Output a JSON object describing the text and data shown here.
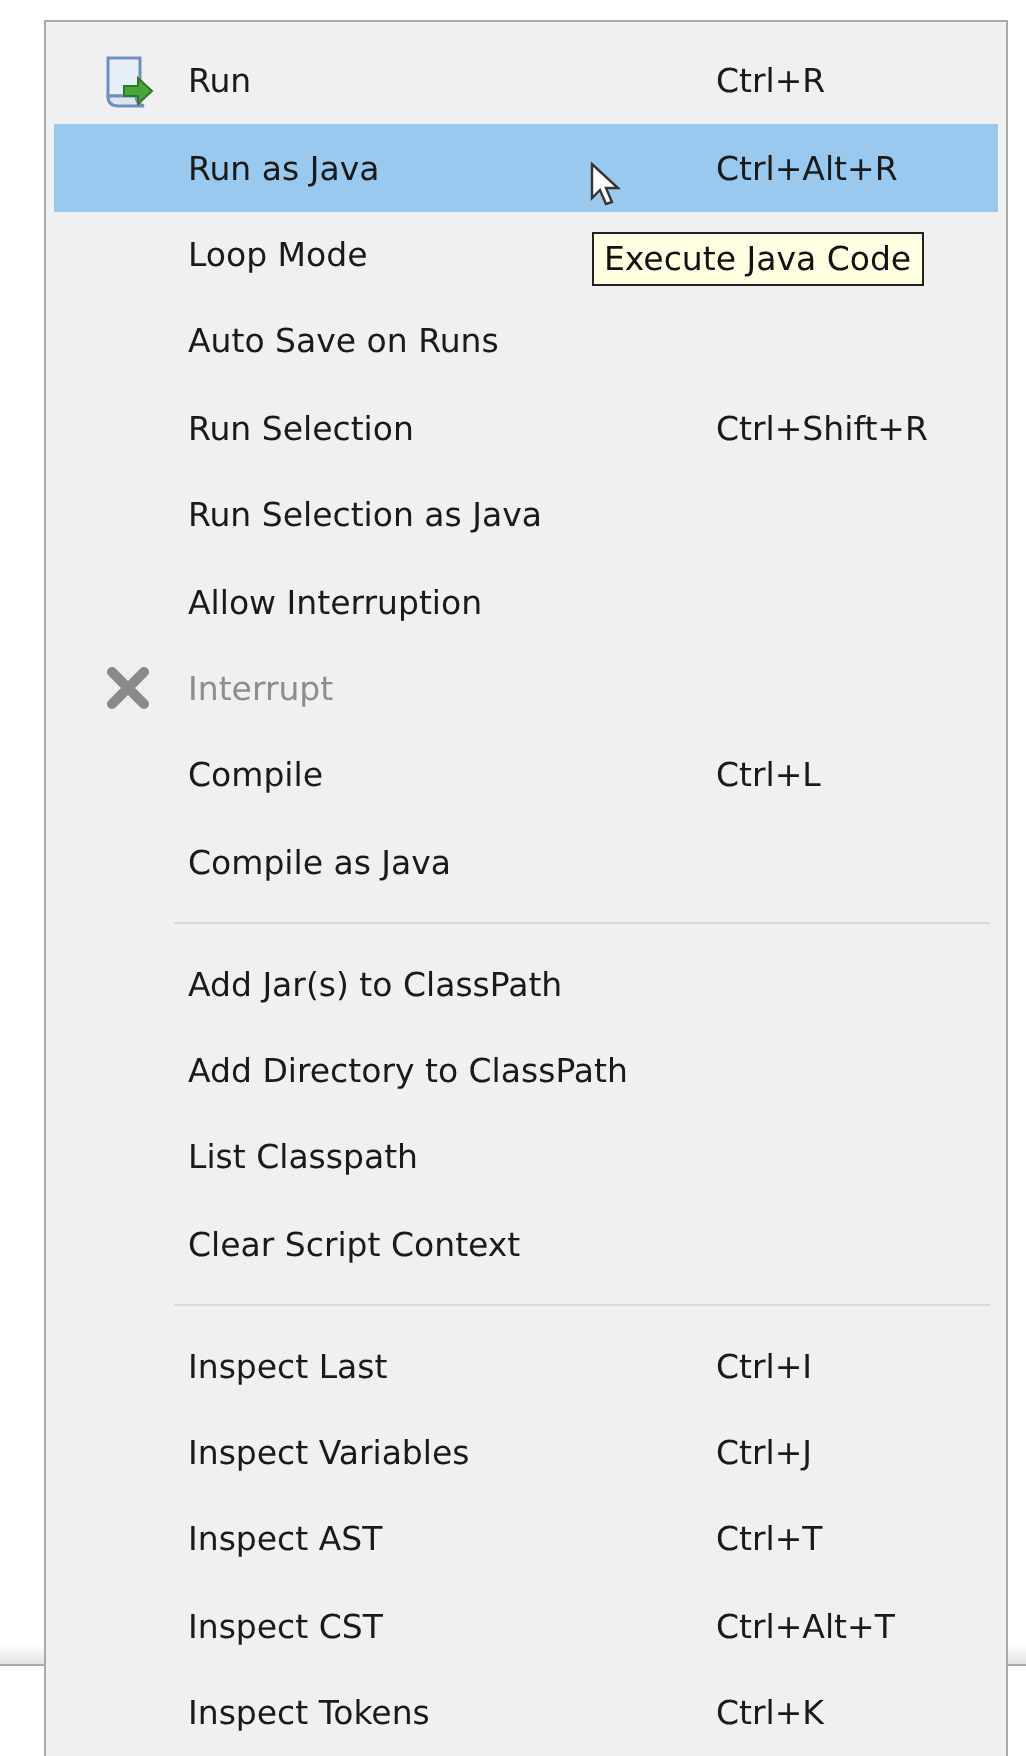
{
  "menu": {
    "items": [
      {
        "kind": "run",
        "label": "Run",
        "shortcut": "Ctrl+R",
        "selected": false,
        "disabled": false
      },
      {
        "kind": "item",
        "label": "Run as Java",
        "shortcut": "Ctrl+Alt+R",
        "selected": true,
        "disabled": false
      },
      {
        "kind": "item",
        "label": "Loop Mode",
        "selected": false,
        "disabled": false
      },
      {
        "kind": "item",
        "label": "Auto Save on Runs",
        "selected": false,
        "disabled": false
      },
      {
        "kind": "item",
        "label": "Run Selection",
        "shortcut": "Ctrl+Shift+R",
        "selected": false,
        "disabled": false
      },
      {
        "kind": "item",
        "label": "Run Selection as Java",
        "selected": false,
        "disabled": false
      },
      {
        "kind": "item",
        "label": "Allow Interruption",
        "selected": false,
        "disabled": false
      },
      {
        "kind": "stop",
        "label": "Interrupt",
        "selected": false,
        "disabled": true
      },
      {
        "kind": "item",
        "label": "Compile",
        "shortcut": "Ctrl+L",
        "selected": false,
        "disabled": false
      },
      {
        "kind": "item",
        "label": "Compile as Java",
        "selected": false,
        "disabled": false
      },
      {
        "kind": "separator"
      },
      {
        "kind": "item",
        "label": "Add Jar(s) to ClassPath",
        "selected": false,
        "disabled": false
      },
      {
        "kind": "item",
        "label": "Add Directory to ClassPath",
        "selected": false,
        "disabled": false
      },
      {
        "kind": "item",
        "label": "List Classpath",
        "selected": false,
        "disabled": false
      },
      {
        "kind": "item",
        "label": "Clear Script Context",
        "selected": false,
        "disabled": false
      },
      {
        "kind": "separator"
      },
      {
        "kind": "item",
        "label": "Inspect Last",
        "shortcut": "Ctrl+I",
        "selected": false,
        "disabled": false
      },
      {
        "kind": "item",
        "label": "Inspect Variables",
        "shortcut": "Ctrl+J",
        "selected": false,
        "disabled": false
      },
      {
        "kind": "item",
        "label": "Inspect AST",
        "shortcut": "Ctrl+T",
        "selected": false,
        "disabled": false
      },
      {
        "kind": "item",
        "label": "Inspect CST",
        "shortcut": "Ctrl+Alt+T",
        "selected": false,
        "disabled": false
      },
      {
        "kind": "item",
        "label": "Inspect Tokens",
        "shortcut": "Ctrl+K",
        "selected": false,
        "disabled": false
      }
    ]
  },
  "tooltip": {
    "text": "Execute Java Code"
  }
}
